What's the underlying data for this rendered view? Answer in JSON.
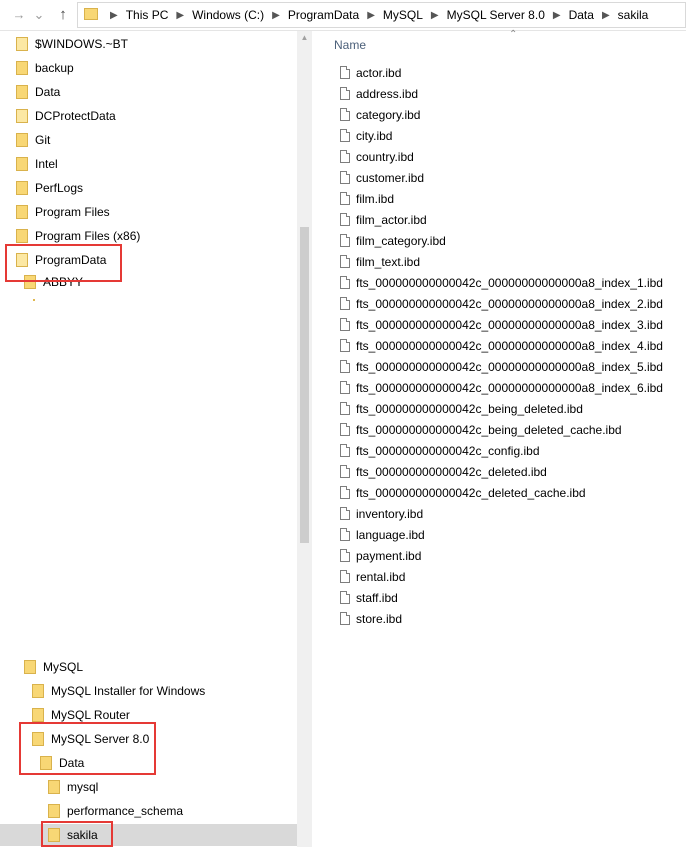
{
  "address": {
    "crumbs": [
      "This PC",
      "Windows (C:)",
      "ProgramData",
      "MySQL",
      "MySQL Server 8.0",
      "Data",
      "sakila"
    ]
  },
  "tree": {
    "items_top": [
      "$WINDOWS.~BT",
      "backup",
      "Data",
      "DCProtectData",
      "Git",
      "Intel",
      "PerfLogs",
      "Program Files",
      "Program Files (x86)",
      "ProgramData",
      "ABBYY"
    ],
    "mysql": "MySQL",
    "mysql_installer": "MySQL Installer for Windows",
    "mysql_router": "MySQL Router",
    "mysql_server": "MySQL Server 8.0",
    "data": "Data",
    "db_mysql": "mysql",
    "db_perf": "performance_schema",
    "db_sakila": "sakila"
  },
  "files": {
    "header": "Name",
    "items": [
      "actor.ibd",
      "address.ibd",
      "category.ibd",
      "city.ibd",
      "country.ibd",
      "customer.ibd",
      "film.ibd",
      "film_actor.ibd",
      "film_category.ibd",
      "film_text.ibd",
      "fts_000000000000042c_00000000000000a8_index_1.ibd",
      "fts_000000000000042c_00000000000000a8_index_2.ibd",
      "fts_000000000000042c_00000000000000a8_index_3.ibd",
      "fts_000000000000042c_00000000000000a8_index_4.ibd",
      "fts_000000000000042c_00000000000000a8_index_5.ibd",
      "fts_000000000000042c_00000000000000a8_index_6.ibd",
      "fts_000000000000042c_being_deleted.ibd",
      "fts_000000000000042c_being_deleted_cache.ibd",
      "fts_000000000000042c_config.ibd",
      "fts_000000000000042c_deleted.ibd",
      "fts_000000000000042c_deleted_cache.ibd",
      "inventory.ibd",
      "language.ibd",
      "payment.ibd",
      "rental.ibd",
      "staff.ibd",
      "store.ibd"
    ]
  },
  "colors": {
    "folder": "#f8d775",
    "highlight": "#e53935",
    "selected": "#d9d9d9"
  }
}
